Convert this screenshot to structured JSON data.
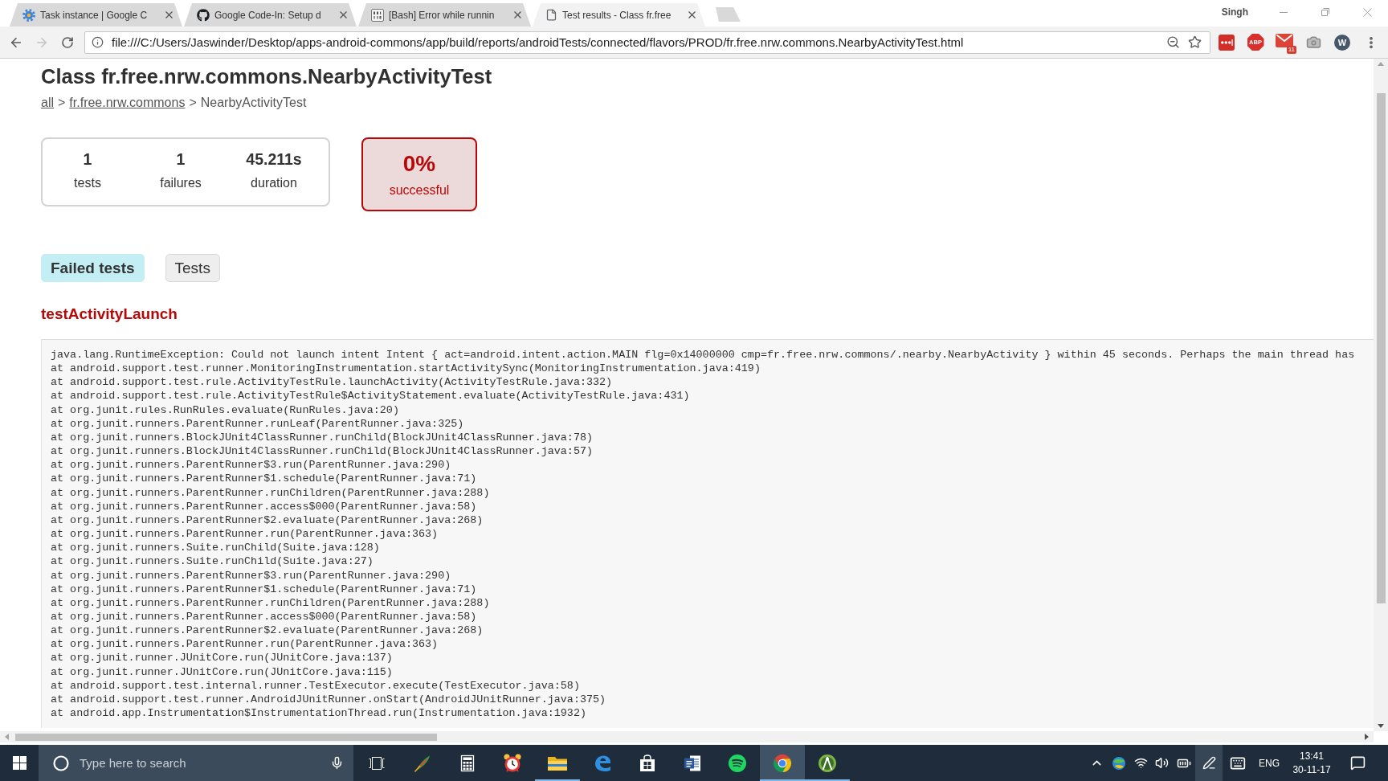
{
  "browser": {
    "tabs": [
      {
        "kind": "gear",
        "title": "Task instance | Google C",
        "selected": false
      },
      {
        "kind": "octocat",
        "title": "Google Code-In: Setup d",
        "selected": false
      },
      {
        "kind": "binary",
        "title": "[Bash] Error while runnin",
        "selected": false
      },
      {
        "kind": "page",
        "title": "Test results - Class fr.free",
        "selected": true
      }
    ],
    "profile": "Singh",
    "back": {
      "disabled": false
    },
    "forward": {
      "disabled": true
    },
    "address": "file:///C:/Users/Jaswinder/Desktop/apps-android-commons/app/build/reports/androidTests/connected/flavors/PROD/fr.free.nrw.commons.NearbyActivityTest.html",
    "extensions": [
      {
        "kind": "dots"
      },
      {
        "kind": "label",
        "label": "ABP"
      },
      {
        "kind": "mail",
        "badge": "11"
      },
      {
        "kind": "camera"
      },
      {
        "kind": "letter",
        "label": "W"
      }
    ]
  },
  "page": {
    "title": "Class fr.free.nrw.commons.NearbyActivityTest",
    "breadcrumb": [
      {
        "kind": "link",
        "label": "all"
      },
      {
        "kind": "separator",
        "label": ">"
      },
      {
        "kind": "link",
        "label": "fr.free.nrw.commons"
      },
      {
        "kind": "separator",
        "label": ">"
      },
      {
        "kind": "current",
        "label": "NearbyActivityTest"
      }
    ],
    "summary": {
      "counters": [
        {
          "value": "1",
          "label": "tests"
        },
        {
          "value": "1",
          "label": "failures"
        },
        {
          "value": "45.211s",
          "label": "duration"
        }
      ],
      "success_rate": {
        "value": "0%",
        "label": "successful",
        "failed": true
      }
    },
    "tabs": [
      {
        "label": "Failed tests",
        "selected": true
      },
      {
        "label": "Tests",
        "selected": false
      }
    ],
    "failed_test": {
      "name": "testActivityLaunch",
      "stack_trace": [
        "java.lang.RuntimeException: Could not launch intent Intent { act=android.intent.action.MAIN flg=0x14000000 cmp=fr.free.nrw.commons/.nearby.NearbyActivity } within 45 seconds. Perhaps the main thread has",
        "at android.support.test.runner.MonitoringInstrumentation.startActivitySync(MonitoringInstrumentation.java:419)",
        "at android.support.test.rule.ActivityTestRule.launchActivity(ActivityTestRule.java:332)",
        "at android.support.test.rule.ActivityTestRule$ActivityStatement.evaluate(ActivityTestRule.java:431)",
        "at org.junit.rules.RunRules.evaluate(RunRules.java:20)",
        "at org.junit.runners.ParentRunner.runLeaf(ParentRunner.java:325)",
        "at org.junit.runners.BlockJUnit4ClassRunner.runChild(BlockJUnit4ClassRunner.java:78)",
        "at org.junit.runners.BlockJUnit4ClassRunner.runChild(BlockJUnit4ClassRunner.java:57)",
        "at org.junit.runners.ParentRunner$3.run(ParentRunner.java:290)",
        "at org.junit.runners.ParentRunner$1.schedule(ParentRunner.java:71)",
        "at org.junit.runners.ParentRunner.runChildren(ParentRunner.java:288)",
        "at org.junit.runners.ParentRunner.access$000(ParentRunner.java:58)",
        "at org.junit.runners.ParentRunner$2.evaluate(ParentRunner.java:268)",
        "at org.junit.runners.ParentRunner.run(ParentRunner.java:363)",
        "at org.junit.runners.Suite.runChild(Suite.java:128)",
        "at org.junit.runners.Suite.runChild(Suite.java:27)",
        "at org.junit.runners.ParentRunner$3.run(ParentRunner.java:290)",
        "at org.junit.runners.ParentRunner$1.schedule(ParentRunner.java:71)",
        "at org.junit.runners.ParentRunner.runChildren(ParentRunner.java:288)",
        "at org.junit.runners.ParentRunner.access$000(ParentRunner.java:58)",
        "at org.junit.runners.ParentRunner$2.evaluate(ParentRunner.java:268)",
        "at org.junit.runners.ParentRunner.run(ParentRunner.java:363)",
        "at org.junit.runner.JUnitCore.run(JUnitCore.java:137)",
        "at org.junit.runner.JUnitCore.run(JUnitCore.java:115)",
        "at android.support.test.internal.runner.TestExecutor.execute(TestExecutor.java:58)",
        "at android.support.test.runner.AndroidJUnitRunner.onStart(AndroidJUnitRunner.java:375)",
        "at android.app.Instrumentation$InstrumentationThread.run(Instrumentation.java:1932)"
      ]
    }
  },
  "taskbar": {
    "search": {
      "placeholder": "Type here to search"
    },
    "apps": [
      {
        "kind": "quill",
        "running": false,
        "selected": false
      },
      {
        "kind": "calculator",
        "running": false,
        "selected": false
      },
      {
        "kind": "alarm",
        "running": false,
        "selected": false
      },
      {
        "kind": "folder",
        "running": true,
        "selected": false
      },
      {
        "kind": "swirl",
        "running": false,
        "selected": false
      },
      {
        "kind": "store",
        "running": false,
        "selected": false
      },
      {
        "kind": "document",
        "running": false,
        "selected": false
      },
      {
        "kind": "waves",
        "running": false,
        "selected": false
      },
      {
        "kind": "browser",
        "running": true,
        "selected": true
      },
      {
        "kind": "compass",
        "running": true,
        "selected": false
      }
    ],
    "tray": {
      "language": "ENG",
      "time": "13:41",
      "date": "30-11-17"
    }
  }
}
